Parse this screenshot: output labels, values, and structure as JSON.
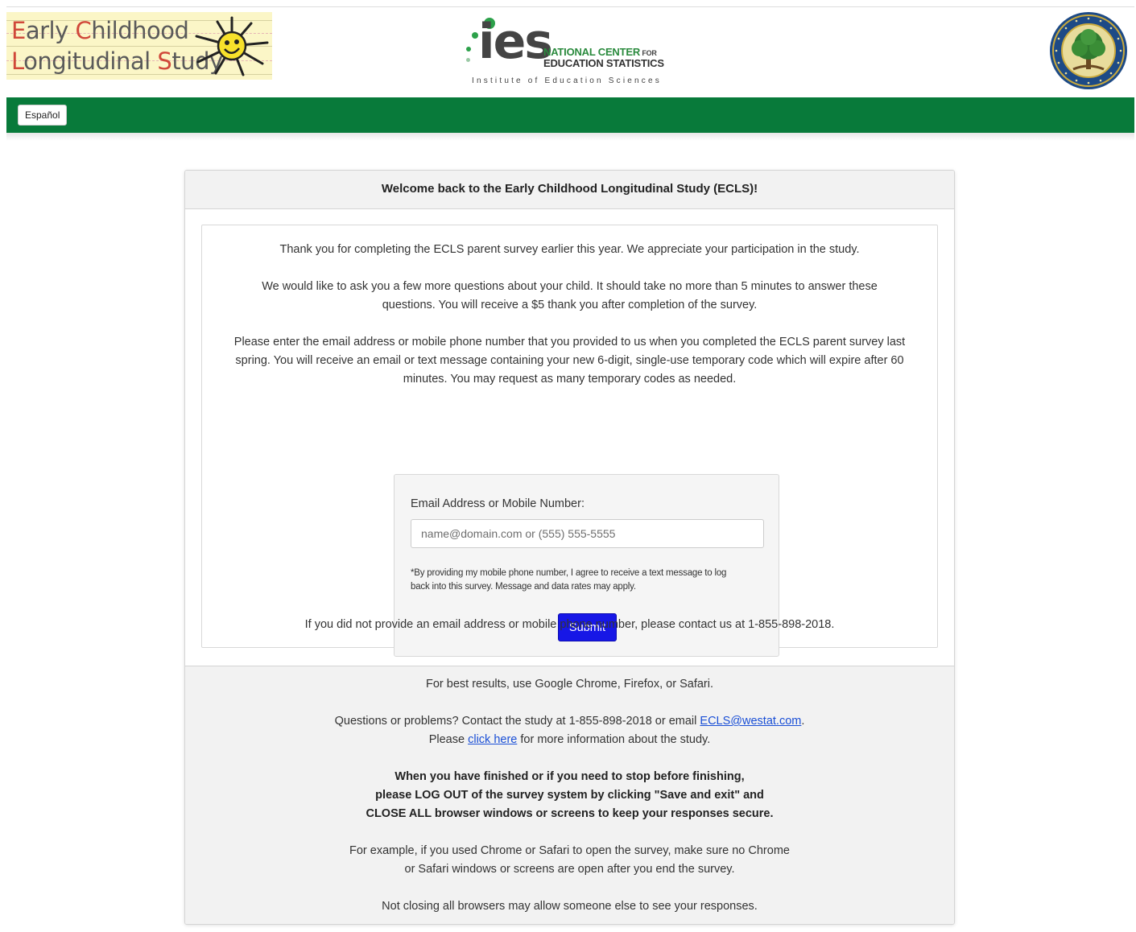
{
  "header": {
    "ecls_logo": {
      "line1_cap": "E",
      "line1_rest": "arly ",
      "line1_cap2": "C",
      "line1_rest2": "hildhood",
      "line2_cap": "L",
      "line2_rest": "ongitudinal ",
      "line2_cap2": "S",
      "line2_rest2": "tudy"
    },
    "ies_logo": {
      "letters": "ies",
      "nces_line1": "NATIONAL CENTER",
      "nces_for": " FOR",
      "nces_line2": "EDUCATION STATISTICS",
      "tagline": "Institute of Education Sciences"
    },
    "seal_icon": "department-of-education-seal-icon"
  },
  "nav": {
    "language_button": "Español",
    "color": "#087a3a"
  },
  "card": {
    "title": "Welcome back to the Early Childhood Longitudinal Study (ECLS)!",
    "paragraph1": "Thank you for completing the ECLS parent survey earlier this year. We appreciate your participation in the study.",
    "paragraph2_line1": "We would like to ask you a few more questions about your child. It should take no more than 5 minutes to answer these",
    "paragraph2_line2": "questions. You will receive a $5 thank you after completion of the survey.",
    "paragraph3_line1": "Please enter the email address or mobile phone number that you provided to us when you completed the ECLS parent survey last",
    "paragraph3_line2": "spring. You will receive an email or text message containing your new 6-digit, single-use temporary code which will expire after 60",
    "paragraph3_line3": "minutes. You may request as many temporary codes as needed.",
    "form": {
      "label": "Email Address or Mobile Number:",
      "value": "",
      "placeholder": "name@domain.com or (555) 555-5555",
      "disclaimer_line1": "*By providing my mobile phone number, I agree to receive a text message to log",
      "disclaimer_line2": "back into this survey. Message and data rates may apply.",
      "submit_label": "Submit",
      "submit_color": "#1717e6"
    },
    "contact_note": "If you did not provide an email address or mobile phone number, please contact us at 1-855-898-2018."
  },
  "footer": {
    "browsers": "For best results, use Google Chrome, Firefox, or Safari.",
    "questions_prefix": "Questions or problems? Contact the study at 1-855-898-2018 or email ",
    "email_link": "ECLS@westat.com",
    "questions_suffix": ".",
    "info_prefix": "Please ",
    "info_link": "click here",
    "info_suffix": " for more information about the study.",
    "bold_line1": "When you have finished or if you need to stop before finishing,",
    "bold_line2": "please LOG OUT of the survey system by clicking \"Save and exit\" and",
    "bold_line3": "CLOSE ALL browser windows or screens to keep your responses secure.",
    "example_line1": "For example, if you used Chrome or Safari to open the survey, make sure no Chrome",
    "example_line2": "or Safari windows or screens are open after you end the survey.",
    "warning": "Not closing all browsers may allow someone else to see your responses."
  }
}
